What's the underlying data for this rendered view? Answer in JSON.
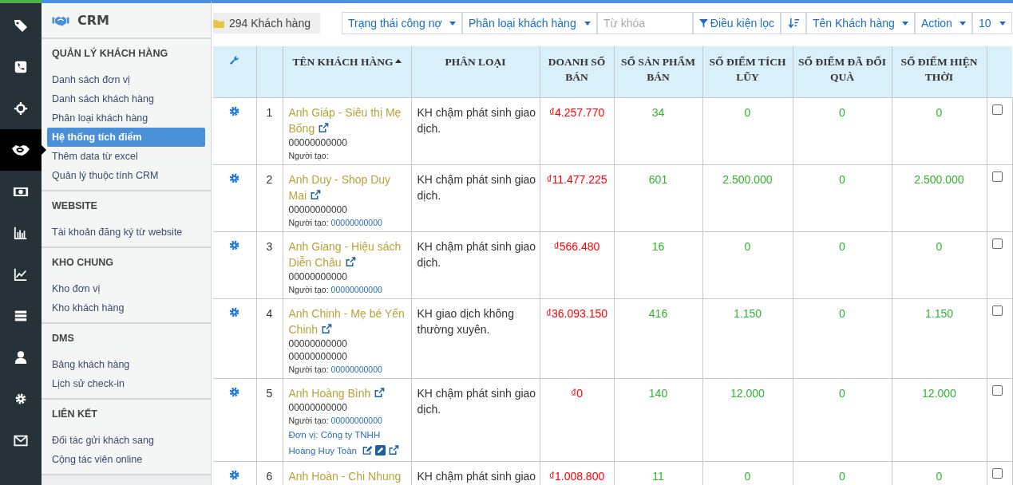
{
  "rail": [
    {
      "selected": false
    },
    {
      "selected": false
    },
    {
      "selected": false
    },
    {
      "selected": true
    },
    {
      "selected": false
    },
    {
      "selected": false
    },
    {
      "selected": false
    },
    {
      "selected": false
    },
    {
      "selected": false
    },
    {
      "selected": false
    },
    {
      "selected": false
    }
  ],
  "sidebar": {
    "title": "CRM",
    "groups": [
      {
        "heading": "QUẢN LÝ KHÁCH HÀNG",
        "items": [
          {
            "label": "Danh sách đơn vị",
            "selected": false
          },
          {
            "label": "Danh sách khách hàng",
            "selected": false
          },
          {
            "label": "Phân loại khách hàng",
            "selected": false
          },
          {
            "label": "Hệ thống tích điểm",
            "selected": true
          },
          {
            "label": "Thêm data từ excel",
            "selected": false
          },
          {
            "label": "Quản lý thuộc tính CRM",
            "selected": false
          }
        ]
      },
      {
        "heading": "WEBSITE",
        "items": [
          {
            "label": "Tài khoản đăng ký từ website",
            "selected": false
          }
        ]
      },
      {
        "heading": "KHO CHUNG",
        "items": [
          {
            "label": "Kho đơn vị",
            "selected": false
          },
          {
            "label": "Kho khách hàng",
            "selected": false
          }
        ]
      },
      {
        "heading": "DMS",
        "items": [
          {
            "label": "Bảng khách hàng",
            "selected": false
          },
          {
            "label": "Lịch sử check-in",
            "selected": false
          }
        ]
      },
      {
        "heading": "LIÊN KẾT",
        "items": [
          {
            "label": "Đối tác gửi khách sang",
            "selected": false
          },
          {
            "label": "Cộng tác viên online",
            "selected": false
          }
        ]
      }
    ]
  },
  "toolbar": {
    "count": "294 Khách hàng",
    "debt_status": "Trạng thái công nợ",
    "category": "Phân loại khách hàng",
    "search": {
      "placeholder": "Từ khóa"
    },
    "filter": "Điều kiện lọc",
    "sort_by": "Tên Khách hàng",
    "action": "Action",
    "page_size": "10"
  },
  "table": {
    "columns": [
      {
        "label": "TÊN KHÁCH HÀNG",
        "sorted": true
      },
      {
        "label": "PHÂN LOẠI",
        "sorted": false
      },
      {
        "label": "DOANH SỐ BÁN",
        "sorted": false
      },
      {
        "label": "SỐ SẢN PHẨM BÁN",
        "sorted": false
      },
      {
        "label": "SỐ ĐIỂM TÍCH LŨY",
        "sorted": false
      },
      {
        "label": "SỐ ĐIỂM ĐÃ ĐỔI QUÀ",
        "sorted": false
      },
      {
        "label": "SỐ ĐIỂM HIỆN THỜI",
        "sorted": false
      }
    ],
    "rows": [
      {
        "index": "1",
        "name": "Anh Giáp - Siêu thị Mẹ Bống",
        "phones": [
          "00000000000"
        ],
        "creator_label": "Người tạo:",
        "category": "KH chậm phát sinh giao dịch.",
        "revenue": "₫4.257.770",
        "products": "34",
        "points_earned": "0",
        "points_redeemed": "0",
        "points_current": "0",
        "checked": false
      },
      {
        "index": "2",
        "name": "Anh Duy - Shop Duy Mai",
        "phones": [
          "00000000000"
        ],
        "creator_label": "Người tạo:",
        "creator": "00000000000",
        "category": "KH chậm phát sinh giao dịch.",
        "revenue": "₫11.477.225",
        "products": "601",
        "points_earned": "2.500.000",
        "points_redeemed": "0",
        "points_current": "2.500.000",
        "checked": false
      },
      {
        "index": "3",
        "name": "Anh Giang - Hiệu sách Diễn Châu",
        "phones": [
          "00000000000"
        ],
        "creator_label": "Người tạo:",
        "creator": "00000000000",
        "category": "KH chậm phát sinh giao dịch.",
        "revenue": "₫566.480",
        "products": "16",
        "points_earned": "0",
        "points_redeemed": "0",
        "points_current": "0",
        "checked": false
      },
      {
        "index": "4",
        "name": "Anh Chinh - Mẹ bé Yến Chinh",
        "phones": [
          "00000000000",
          "00000000000"
        ],
        "creator_label": "Người tạo:",
        "creator": "00000000000",
        "category": "KH giao dịch không thường xuyên.",
        "revenue": "₫36.093.150",
        "products": "416",
        "points_earned": "1.150",
        "points_redeemed": "0",
        "points_current": "1.150",
        "checked": false
      },
      {
        "index": "5",
        "name": "Anh Hoàng Bình",
        "phones": [
          "00000000000"
        ],
        "creator_label": "Người tạo:",
        "creator": "00000000000",
        "unit": "Đơn vị: Công ty TNHH Hoàng Huy Toàn",
        "category": "KH chậm phát sinh giao dịch.",
        "revenue": "₫0",
        "products": "140",
        "points_earned": "12.000",
        "points_redeemed": "0",
        "points_current": "12.000",
        "checked": false
      },
      {
        "index": "6",
        "name": "Anh Hoàn - Chi Nhung",
        "phones": [],
        "category": "KH chậm phát sinh giao",
        "revenue": "₫1.008.800",
        "products": "11",
        "points_earned": "0",
        "points_redeemed": "0",
        "points_current": "0",
        "checked": false
      }
    ]
  }
}
